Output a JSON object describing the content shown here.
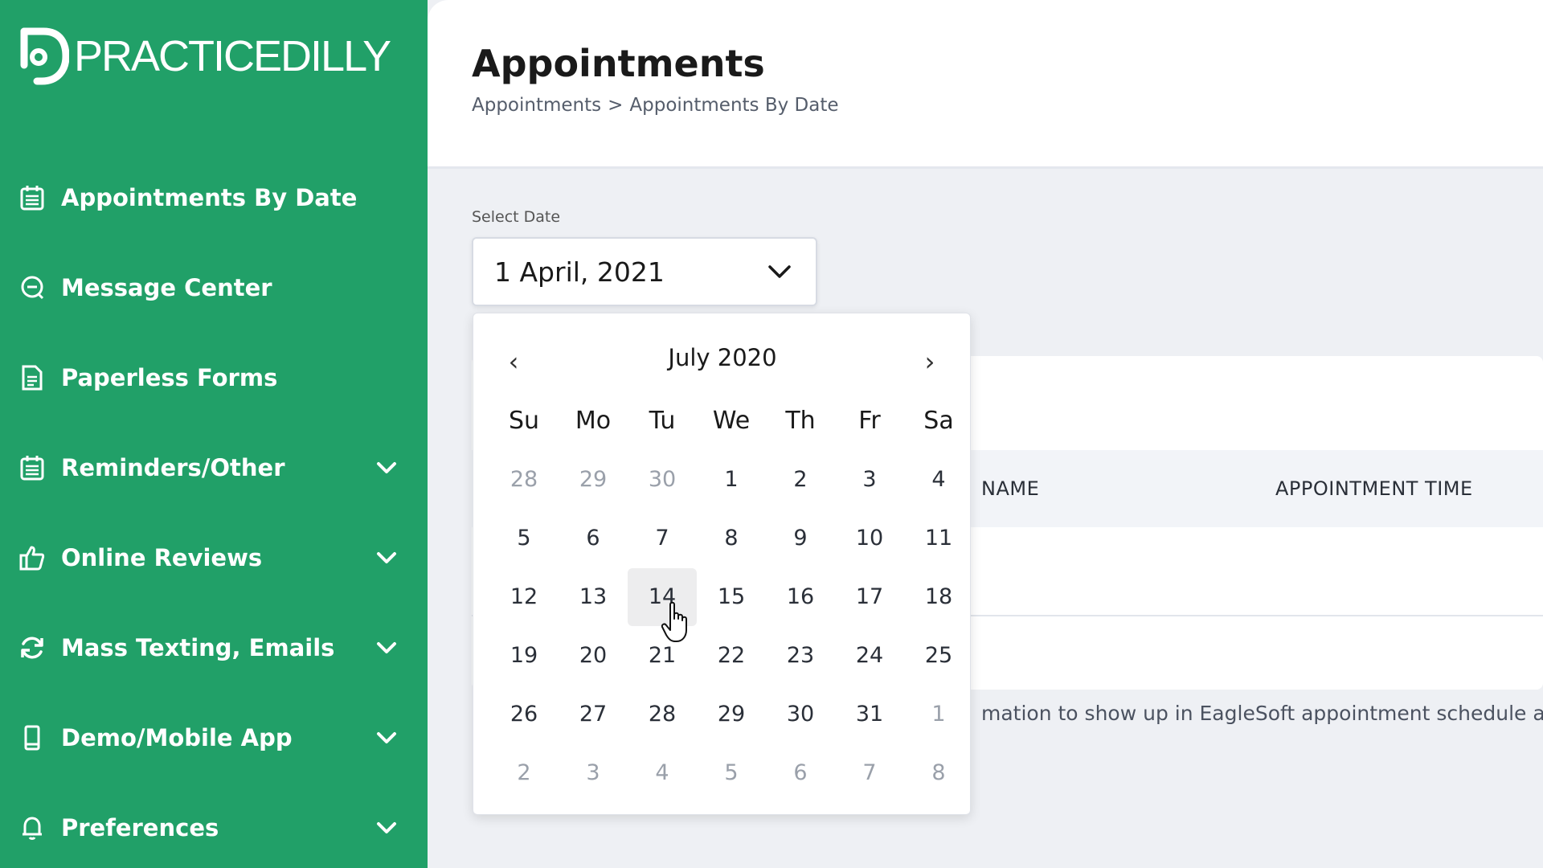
{
  "brand": {
    "name": "PRACTICEDILLY",
    "color": "#21a068"
  },
  "sidebar": {
    "items": [
      {
        "label": "Appointments By Date",
        "icon": "calendar-icon",
        "expandable": false
      },
      {
        "label": "Message Center",
        "icon": "chat-icon",
        "expandable": false
      },
      {
        "label": "Paperless Forms",
        "icon": "document-icon",
        "expandable": false
      },
      {
        "label": "Reminders/Other",
        "icon": "calendar-icon",
        "expandable": true
      },
      {
        "label": "Online Reviews",
        "icon": "thumbs-up-icon",
        "expandable": true
      },
      {
        "label": "Mass Texting, Emails",
        "icon": "refresh-icon",
        "expandable": true
      },
      {
        "label": "Demo/Mobile App",
        "icon": "mobile-icon",
        "expandable": true
      },
      {
        "label": "Preferences",
        "icon": "bell-icon",
        "expandable": true
      }
    ]
  },
  "header": {
    "title": "Appointments",
    "breadcrumb": {
      "root": "Appointments",
      "separator": ">",
      "current": "Appointments By Date"
    }
  },
  "date_picker": {
    "label": "Select Date",
    "value": "1 April, 2021",
    "calendar": {
      "month_label": "July 2020",
      "prev": "‹",
      "next": "›",
      "weekdays": [
        "Su",
        "Mo",
        "Tu",
        "We",
        "Th",
        "Fr",
        "Sa"
      ],
      "weeks": [
        [
          {
            "d": "28",
            "o": true
          },
          {
            "d": "29",
            "o": true
          },
          {
            "d": "30",
            "o": true
          },
          {
            "d": "1"
          },
          {
            "d": "2"
          },
          {
            "d": "3"
          },
          {
            "d": "4"
          }
        ],
        [
          {
            "d": "5"
          },
          {
            "d": "6"
          },
          {
            "d": "7"
          },
          {
            "d": "8"
          },
          {
            "d": "9"
          },
          {
            "d": "10"
          },
          {
            "d": "11"
          }
        ],
        [
          {
            "d": "12"
          },
          {
            "d": "13"
          },
          {
            "d": "14",
            "h": true
          },
          {
            "d": "15"
          },
          {
            "d": "16"
          },
          {
            "d": "17"
          },
          {
            "d": "18"
          }
        ],
        [
          {
            "d": "19"
          },
          {
            "d": "20"
          },
          {
            "d": "21"
          },
          {
            "d": "22"
          },
          {
            "d": "23"
          },
          {
            "d": "24"
          },
          {
            "d": "25"
          }
        ],
        [
          {
            "d": "26"
          },
          {
            "d": "27"
          },
          {
            "d": "28"
          },
          {
            "d": "29"
          },
          {
            "d": "30"
          },
          {
            "d": "31"
          },
          {
            "d": "1",
            "o": true
          }
        ],
        [
          {
            "d": "2",
            "o": true
          },
          {
            "d": "3",
            "o": true
          },
          {
            "d": "4",
            "o": true
          },
          {
            "d": "5",
            "o": true
          },
          {
            "d": "6",
            "o": true
          },
          {
            "d": "7",
            "o": true
          },
          {
            "d": "8",
            "o": true
          }
        ]
      ]
    }
  },
  "table": {
    "columns": [
      "NAME",
      "APPOINTMENT TIME"
    ]
  },
  "note": "mation to show up in EagleSoft appointment schedule after"
}
